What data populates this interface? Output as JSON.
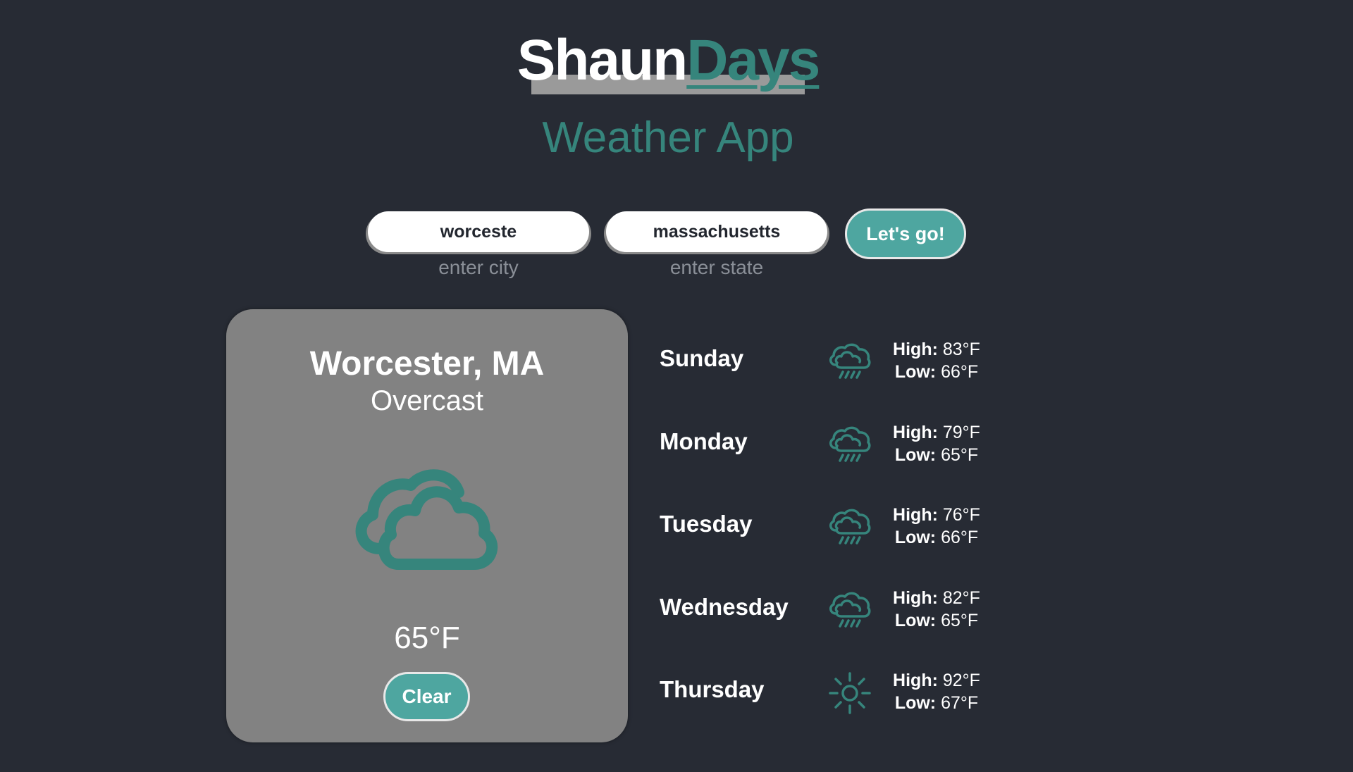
{
  "brand": {
    "part1": "Shaun",
    "part2": "Days"
  },
  "subtitle": "Weather App",
  "search": {
    "city_value": "worceste",
    "city_hint": "enter city",
    "state_value": "massachusetts",
    "state_hint": "enter state",
    "submit_label": "Let's go!"
  },
  "current": {
    "location": "Worcester, MA",
    "condition": "Overcast",
    "icon": "overcast-clouds-icon",
    "temperature": "65°F",
    "clear_label": "Clear"
  },
  "forecast_labels": {
    "high": "High:",
    "low": "Low:"
  },
  "forecast": [
    {
      "day": "Sunday",
      "icon": "rain-cloud-icon",
      "high": "83°F",
      "low": "66°F"
    },
    {
      "day": "Monday",
      "icon": "rain-cloud-icon",
      "high": "79°F",
      "low": "65°F"
    },
    {
      "day": "Tuesday",
      "icon": "rain-cloud-icon",
      "high": "76°F",
      "low": "66°F"
    },
    {
      "day": "Wednesday",
      "icon": "rain-cloud-icon",
      "high": "82°F",
      "low": "65°F"
    },
    {
      "day": "Thursday",
      "icon": "sun-icon",
      "high": "92°F",
      "low": "67°F"
    }
  ],
  "colors": {
    "background": "#272b34",
    "accent": "#36857c",
    "button": "#4ea6a0",
    "card": "#828282"
  }
}
